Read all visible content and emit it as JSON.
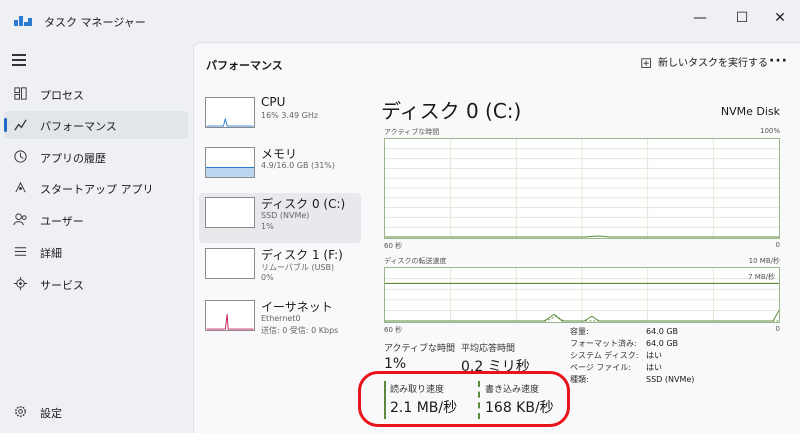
{
  "window": {
    "title": "タスク マネージャー",
    "minimize": "—",
    "maximize": "☐",
    "close": "✕"
  },
  "nav": {
    "items": [
      {
        "label": "プロセス",
        "icon": "processes-icon"
      },
      {
        "label": "パフォーマンス",
        "icon": "performance-icon",
        "active": true
      },
      {
        "label": "アプリの履歴",
        "icon": "app-history-icon"
      },
      {
        "label": "スタートアップ アプリ",
        "icon": "startup-icon"
      },
      {
        "label": "ユーザー",
        "icon": "users-icon"
      },
      {
        "label": "詳細",
        "icon": "details-icon"
      },
      {
        "label": "サービス",
        "icon": "services-icon"
      }
    ],
    "settings": "設定"
  },
  "header": {
    "title": "パフォーマンス",
    "run_task": "新しいタスクを実行する",
    "more": "···"
  },
  "devices": [
    {
      "name": "CPU",
      "line1": "16%  3.49 GHz",
      "line2": ""
    },
    {
      "name": "メモリ",
      "line1": "4.9/16.0 GB (31%)",
      "line2": ""
    },
    {
      "name": "ディスク 0 (C:)",
      "line1": "SSD (NVMe)",
      "line2": "1%",
      "selected": true
    },
    {
      "name": "ディスク 1 (F:)",
      "line1": "リムーバブル (USB)",
      "line2": "0%"
    },
    {
      "name": "イーサネット",
      "line1": "Ethernet0",
      "line2": "送信: 0 受信: 0 Kbps"
    }
  ],
  "detail": {
    "title": "ディスク 0 (C:)",
    "model": "NVMe Disk",
    "graph1": {
      "label": "アクティブな時間",
      "max": "100%",
      "time_left": "60 秒",
      "time_right": "0"
    },
    "graph2": {
      "label": "ディスクの転送速度",
      "max": "10 MB/秒",
      "line_label": "7 MB/秒",
      "time_left": "60 秒",
      "time_right": "0"
    },
    "stats": {
      "active_label": "アクティブな時間",
      "active_value": "1%",
      "response_label": "平均応答時間",
      "response_value": "0.2 ミリ秒",
      "read_label": "読み取り速度",
      "read_value": "2.1 MB/秒",
      "write_label": "書き込み速度",
      "write_value": "168 KB/秒"
    },
    "props": [
      {
        "k": "容量:",
        "v": "64.0 GB"
      },
      {
        "k": "フォーマット済み:",
        "v": "64.0 GB"
      },
      {
        "k": "システム ディスク:",
        "v": "はい"
      },
      {
        "k": "ページ ファイル:",
        "v": "はい"
      },
      {
        "k": "種類:",
        "v": "SSD (NVMe)"
      }
    ]
  },
  "colors": {
    "accent": "#2169c4",
    "disk_green": "#5a8a3a",
    "highlight": "#e8141c"
  }
}
